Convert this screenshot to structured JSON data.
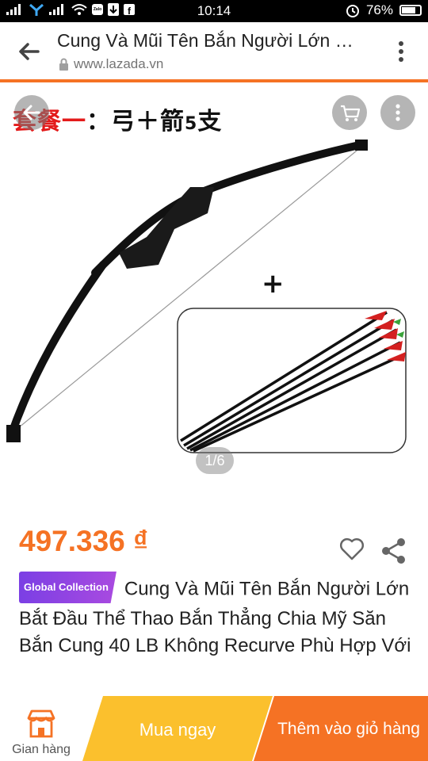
{
  "status_bar": {
    "time": "10:14",
    "battery": "76%",
    "app_labels": [
      "Zalo"
    ]
  },
  "browser": {
    "title": "Cung Và Mũi Tên Bắn Người Lớn Bắt Đầu Thể Thao Bắn Thẳng Chia Mỹ Săn Bắn Cung 40 LB Không Recurve Phù Hợp Với",
    "url": "www.lazada.vn"
  },
  "image": {
    "promo_red": "套餐一",
    "promo_black": "：弓＋箭",
    "promo_num": "5",
    "promo_tail": "支",
    "plus_sign": "+",
    "indicator": "1/6"
  },
  "product": {
    "price": "497.336 ₫",
    "badge": "Global Collection",
    "description": "Cung Và Mũi Tên Bắn Người Lớn Bắt Đầu Thể Thao Bắn Thẳng Chia Mỹ Săn Bắn Cung 40 LB Không Recurve Phù Hợp Với"
  },
  "bottom_bar": {
    "store_label": "Gian hàng",
    "buy_now": "Mua ngay",
    "add_to_cart": "Thêm vào giỏ hàng"
  },
  "colors": {
    "accent": "#f57224",
    "buy_now": "#fbc02d",
    "badge": "#8a44e2"
  }
}
